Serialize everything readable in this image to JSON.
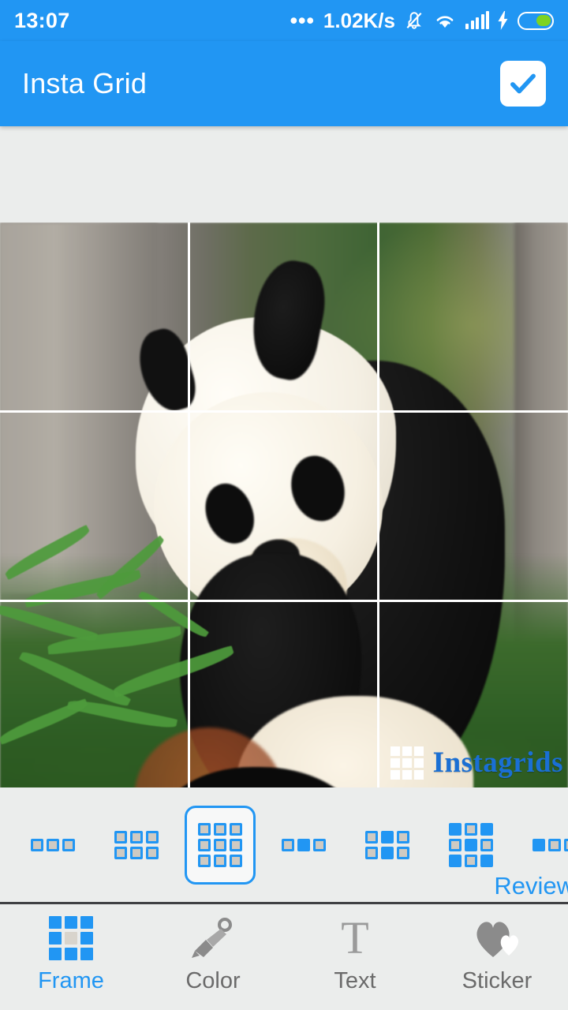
{
  "status_bar": {
    "time": "13:07",
    "dots": "•••",
    "net_speed": "1.02K/s",
    "icons": [
      "mute-icon",
      "wifi-icon",
      "signal-icon",
      "charging-icon",
      "battery-icon"
    ]
  },
  "app_bar": {
    "title": "Insta Grid",
    "confirm_label": "✓"
  },
  "canvas": {
    "image_subject": "panda eating bamboo",
    "grid_rows": 3,
    "grid_cols": 3,
    "grid_line_color": "#ffffff",
    "watermark_text": "Instagrids"
  },
  "frame_strip": {
    "review_label": "Review",
    "selected_index": 2,
    "options": [
      {
        "name": "1x3",
        "rows": 1,
        "cols": 3,
        "filled": []
      },
      {
        "name": "2x3",
        "rows": 2,
        "cols": 3,
        "filled": []
      },
      {
        "name": "3x3",
        "rows": 3,
        "cols": 3,
        "filled": []
      },
      {
        "name": "1x3-center",
        "rows": 1,
        "cols": 3,
        "filled": [
          1
        ]
      },
      {
        "name": "2x3-center-col",
        "rows": 2,
        "cols": 3,
        "filled": [
          1,
          4
        ]
      },
      {
        "name": "3x3-checker",
        "rows": 3,
        "cols": 3,
        "filled": [
          0,
          2,
          4,
          6,
          8
        ]
      },
      {
        "name": "1x3-first",
        "rows": 1,
        "cols": 3,
        "filled": [
          0
        ]
      }
    ]
  },
  "toolbar": {
    "active_index": 0,
    "items": [
      {
        "label": "Frame",
        "icon": "grid-icon"
      },
      {
        "label": "Color",
        "icon": "paintbrush-icon"
      },
      {
        "label": "Text",
        "icon": "text-icon"
      },
      {
        "label": "Sticker",
        "icon": "heart-icon"
      }
    ]
  },
  "colors": {
    "accent": "#2196f3",
    "background": "#ebedec",
    "divider": "#3f4043",
    "inactive_text": "#6b6b6b"
  }
}
